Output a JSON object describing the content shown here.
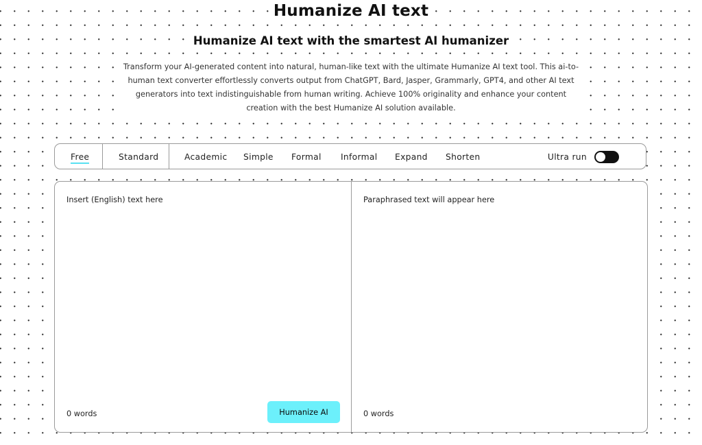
{
  "header": {
    "title": "Humanize AI text",
    "subtitle": "Humanize AI text with the smartest AI humanizer",
    "description": "Transform your AI-generated content into natural, human-like text with the ultimate Humanize AI text tool. This ai-to-human text converter effortlessly converts output from ChatGPT, Bard, Jasper, Grammarly, GPT4, and other AI text generators into text indistinguishable from human writing. Achieve 100% originality and enhance your content creation with the best Humanize AI solution available."
  },
  "modes": {
    "tabs": [
      {
        "label": "Free",
        "active": true
      },
      {
        "label": "Standard",
        "active": false
      },
      {
        "label": "Academic",
        "active": false
      },
      {
        "label": "Simple",
        "active": false
      },
      {
        "label": "Formal",
        "active": false
      },
      {
        "label": "Informal",
        "active": false
      },
      {
        "label": "Expand",
        "active": false
      },
      {
        "label": "Shorten",
        "active": false
      }
    ],
    "ultra_run_label": "Ultra run",
    "ultra_run_enabled": false
  },
  "editor": {
    "input_placeholder": "Insert (English) text here",
    "input_value": "",
    "input_word_count": "0 words",
    "humanize_button_label": "Humanize AI",
    "output_placeholder": "Paraphrased text will appear here",
    "output_word_count": "0 words"
  },
  "colors": {
    "accent": "#6cf0fb",
    "active_tab_underline": "#58e0f2",
    "border": "#9a9a9a",
    "toggle_track": "#111111"
  }
}
